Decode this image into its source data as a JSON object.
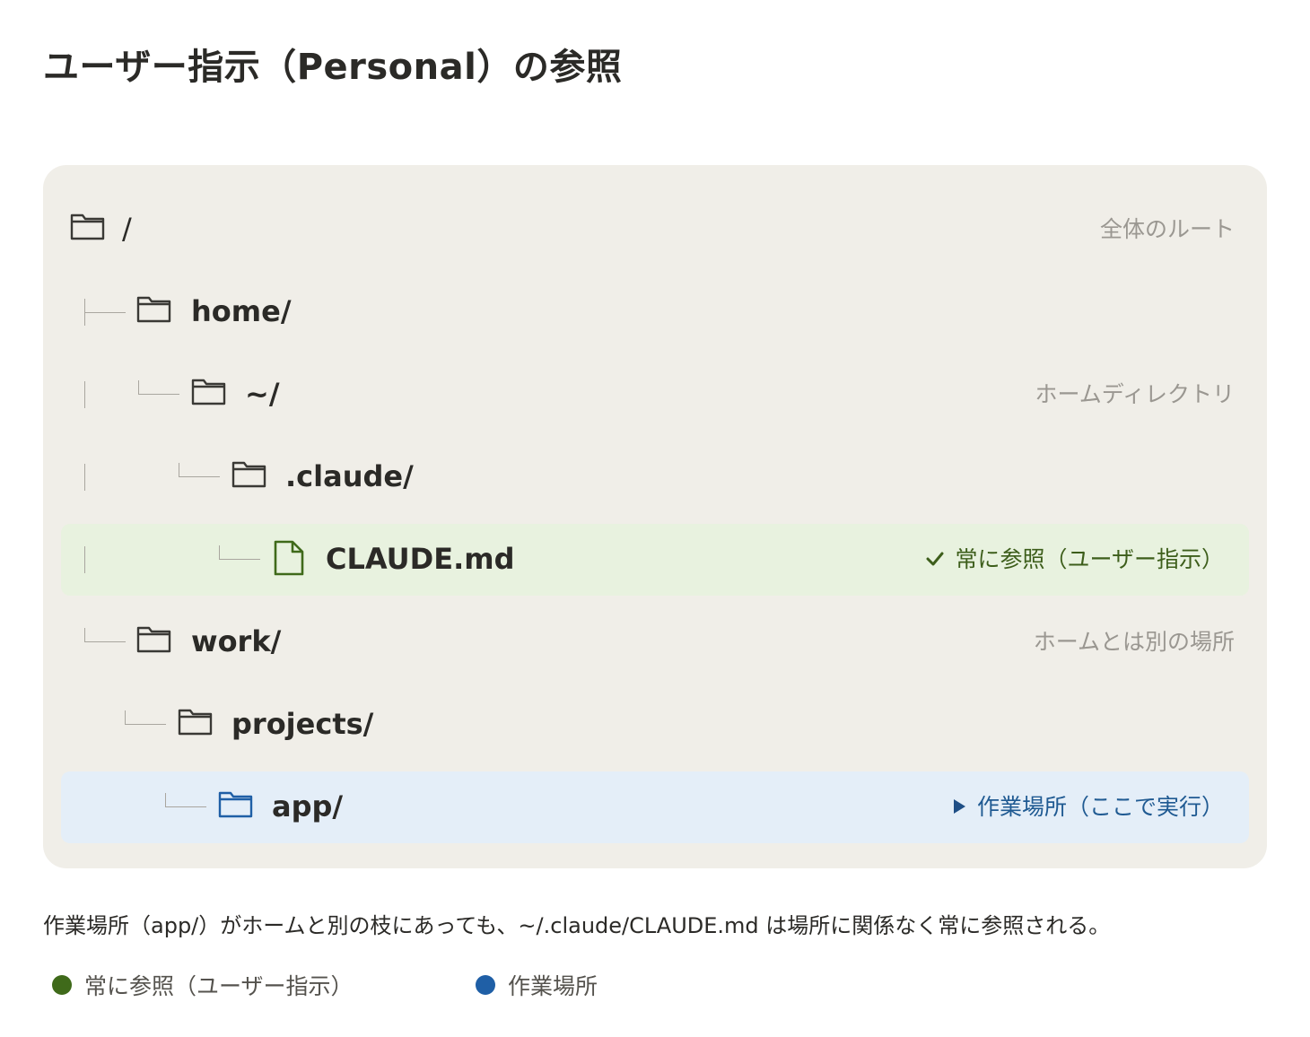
{
  "title": "ユーザー指示（Personal）の参照",
  "tree": {
    "root": {
      "label": "/",
      "note": "全体のルート"
    },
    "home": {
      "label": "home/"
    },
    "tilde": {
      "label": "~/",
      "note": "ホームディレクトリ"
    },
    "claude_dir": {
      "label": ".claude/"
    },
    "claude_md": {
      "label": "CLAUDE.md",
      "status": "常に参照（ユーザー指示）"
    },
    "work": {
      "label": "work/",
      "note": "ホームとは別の場所"
    },
    "projects": {
      "label": "projects/"
    },
    "app": {
      "label": "app/",
      "status": "作業場所（ここで実行）"
    }
  },
  "caption": "作業場所（app/）がホームと別の枝にあっても、~/.claude/CLAUDE.md は場所に関係なく常に参照される。",
  "legend": [
    {
      "label": "常に参照（ユーザー指示）",
      "color": "#3f6a1a"
    },
    {
      "label": "作業場所",
      "color": "#1f5fa6"
    }
  ],
  "colors": {
    "panel": "#f0eee8",
    "green_highlight": "#e8f2df",
    "blue_highlight": "#e4eef8",
    "green": "#3f6a1a",
    "blue": "#1f5fa6"
  },
  "icons": {
    "folder": "folder-icon",
    "file": "file-icon",
    "check": "check-icon",
    "play": "play-icon"
  }
}
